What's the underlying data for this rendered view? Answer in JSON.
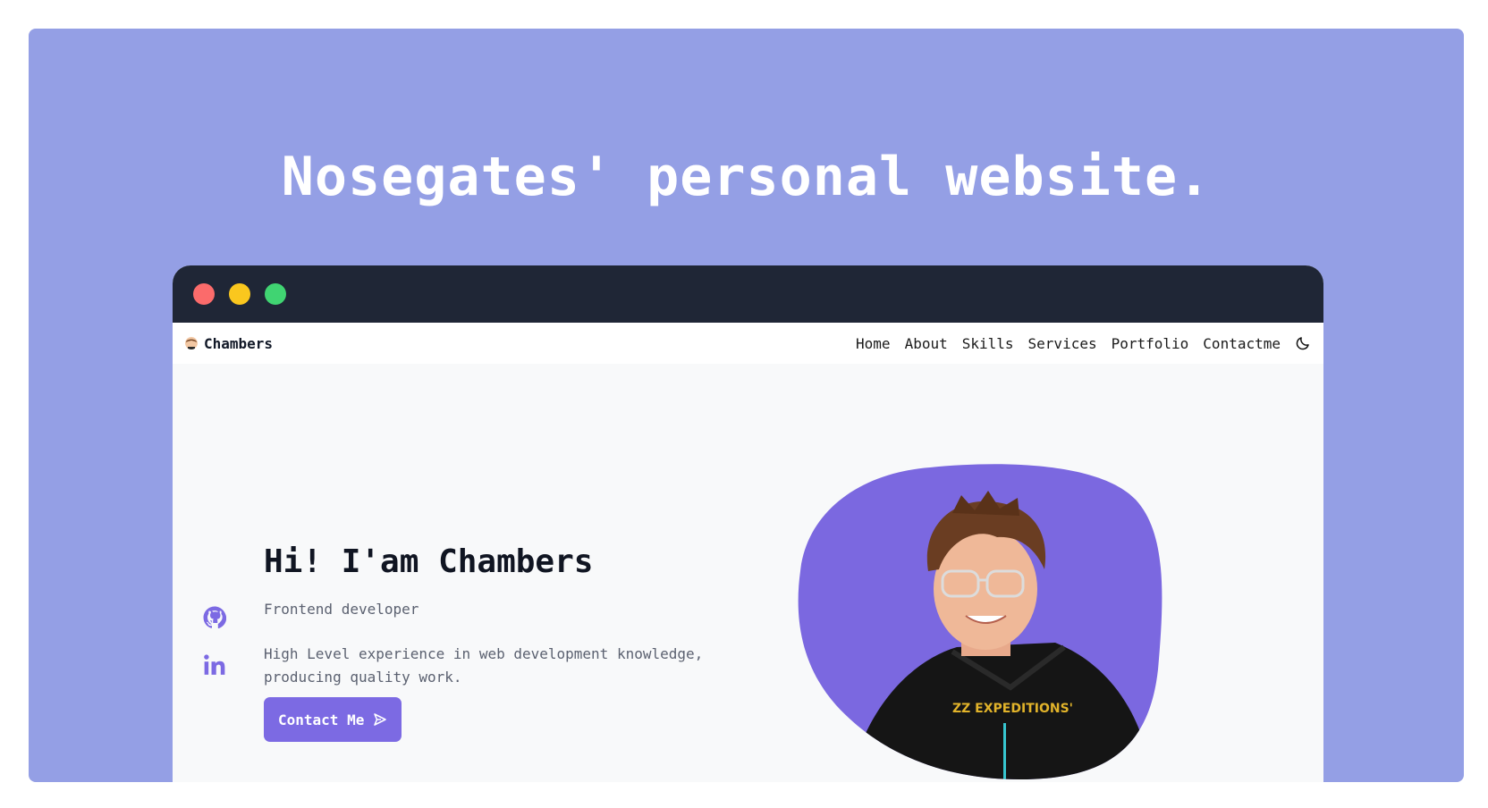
{
  "banner": {
    "title": "Nosegates' personal website.",
    "background": "#949fe5"
  },
  "browser": {
    "titlebar_color": "#1f2636",
    "dots": [
      "#fb6b6b",
      "#fac71e",
      "#40d472"
    ]
  },
  "navbar": {
    "brand": "Chambers",
    "brand_icon": "avatar-icon",
    "links": [
      "Home",
      "About",
      "Skills",
      "Services",
      "Portfolio",
      "Contactme"
    ],
    "theme_toggle_icon": "moon-icon"
  },
  "hero": {
    "greeting": "Hi! I'am Chambers",
    "role": "Frontend developer",
    "description": "High Level experience in web development knowledge, producing quality work.",
    "cta_label": "Contact Me",
    "cta_icon": "send-icon",
    "social_icons": [
      "github-icon",
      "linkedin-icon"
    ],
    "accent_color": "#7c6ae3",
    "photo": "profile-photo"
  }
}
